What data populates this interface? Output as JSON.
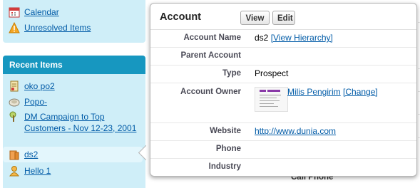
{
  "sidebar": {
    "links": [
      {
        "label": "Calendar",
        "icon": "calendar-icon"
      },
      {
        "label": "Unresolved Items",
        "icon": "warning-icon"
      }
    ],
    "recent_header": "Recent Items",
    "recent": [
      {
        "label": "oko po2",
        "icon": "contract-icon"
      },
      {
        "label": "Popo-",
        "icon": "lead-icon"
      },
      {
        "label": "DM Campaign to Top Customers - Nov 12-23, 2001",
        "icon": "campaign-icon"
      },
      {
        "label": "ds2",
        "icon": "account-icon",
        "selected": true
      },
      {
        "label": "Hello 1",
        "icon": "contact-icon"
      }
    ]
  },
  "background": {
    "partial_label": "Call Phone"
  },
  "popup": {
    "title": "Account",
    "view_label": "View",
    "edit_label": "Edit",
    "fields": {
      "account_name_label": "Account Name",
      "account_name_value": "ds2",
      "view_hierarchy_label": "[View Hierarchy]",
      "parent_account_label": "Parent Account",
      "parent_account_value": "",
      "type_label": "Type",
      "type_value": "Prospect",
      "account_owner_label": "Account Owner",
      "owner_name": "Milis Pengirim",
      "change_label": "[Change]",
      "website_label": "Website",
      "website_value": "http://www.dunia.com",
      "phone_label": "Phone",
      "phone_value": "",
      "industry_label": "Industry",
      "industry_value": ""
    }
  },
  "colors": {
    "sidebar_bg": "#cfeef8",
    "header_bg": "#1797c0",
    "link": "#015ba7"
  }
}
